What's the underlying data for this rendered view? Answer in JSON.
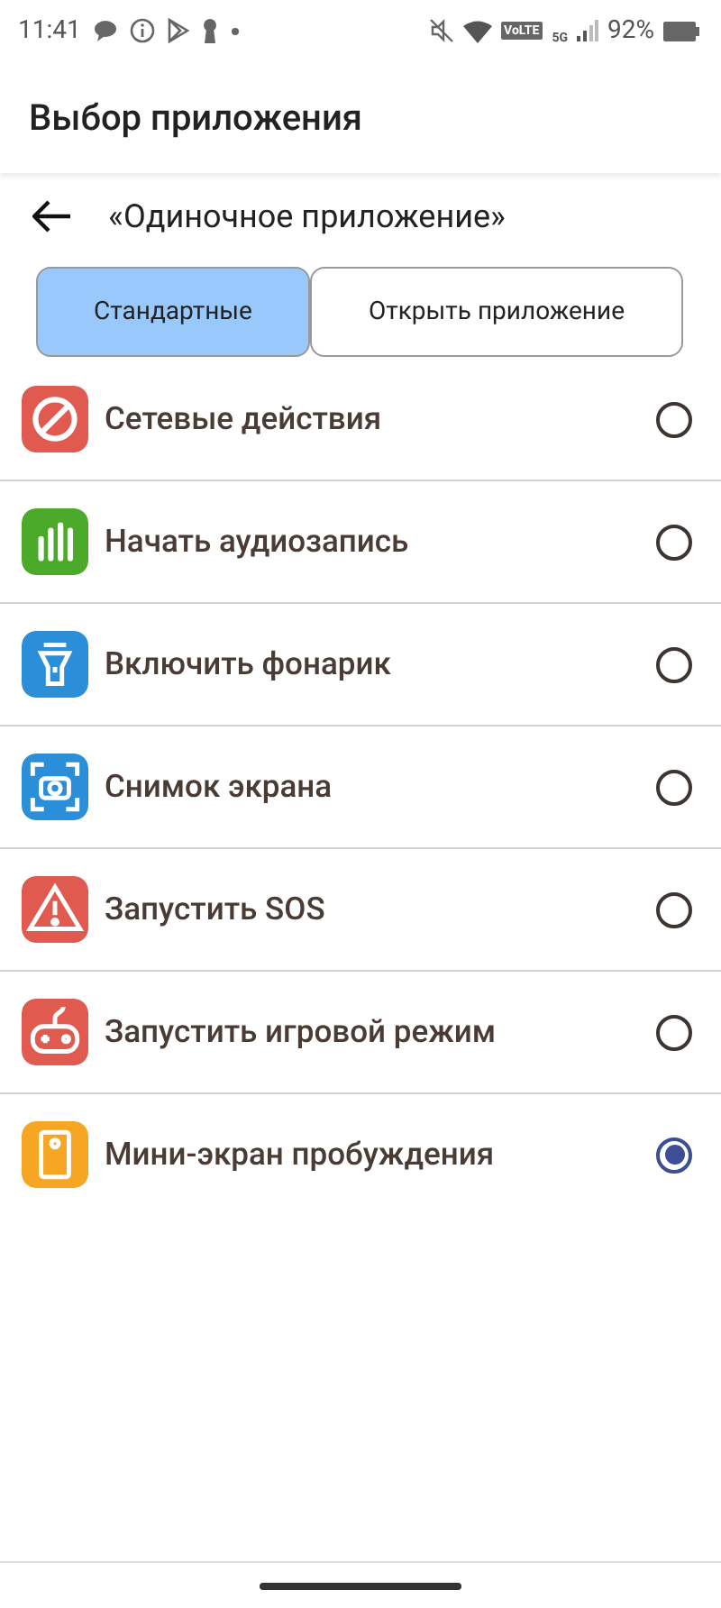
{
  "status_bar": {
    "time": "11:41",
    "network_badge": "VoLTE",
    "network_type": "5G",
    "battery": "92%"
  },
  "app_bar": {
    "title": "Выбор приложения"
  },
  "subheader": {
    "title": "«Одиночное приложение»"
  },
  "tabs": [
    {
      "label": "Стандартные",
      "selected": true
    },
    {
      "label": "Открыть приложение",
      "selected": false
    }
  ],
  "actions": [
    {
      "label": "Сетевые действия",
      "kind": "block",
      "color": "#e05a4f",
      "selected": false
    },
    {
      "label": "Начать аудиозапись",
      "kind": "audio",
      "color": "#4caa2a",
      "selected": false
    },
    {
      "label": "Включить фонарик",
      "kind": "flashlight",
      "color": "#2a8fd8",
      "selected": false
    },
    {
      "label": "Снимок экрана",
      "kind": "screenshot",
      "color": "#2a8fd8",
      "selected": false
    },
    {
      "label": "Запустить SOS",
      "kind": "warning",
      "color": "#e05a4f",
      "selected": false
    },
    {
      "label": "Запустить игровой режим",
      "kind": "gamepad",
      "color": "#e05a4f",
      "selected": false
    },
    {
      "label": "Мини-экран пробуждения",
      "kind": "phone",
      "color": "#f6a623",
      "selected": true
    }
  ]
}
